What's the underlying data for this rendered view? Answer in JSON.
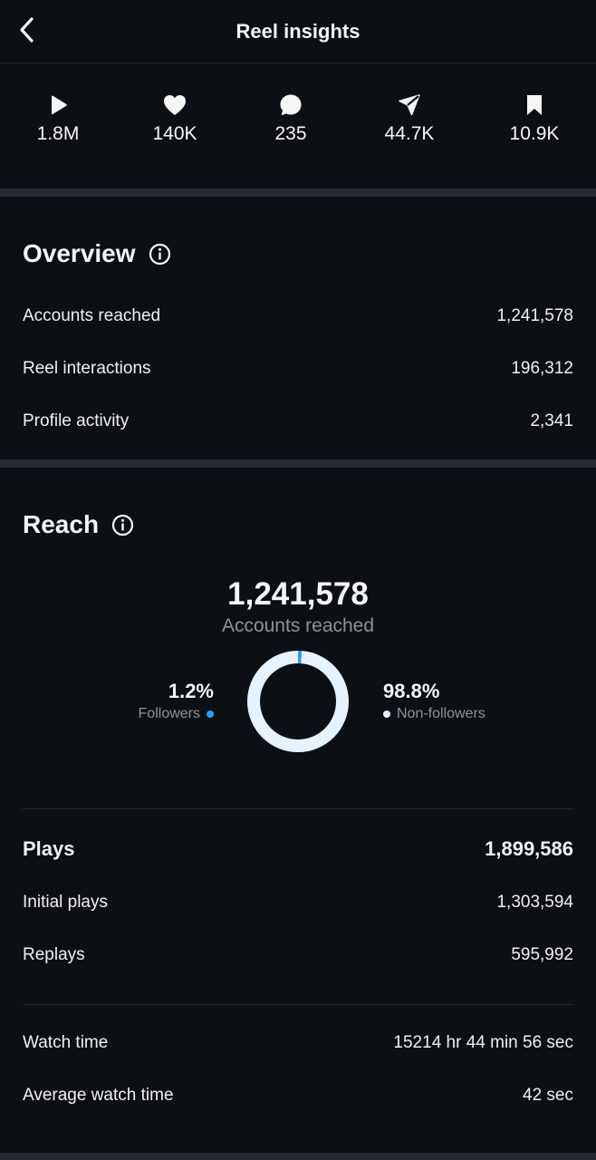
{
  "header": {
    "title": "Reel insights",
    "back_icon": "chevron-left-icon"
  },
  "stats": [
    {
      "icon": "play-icon",
      "value": "1.8M"
    },
    {
      "icon": "heart-icon",
      "value": "140K"
    },
    {
      "icon": "comment-icon",
      "value": "235"
    },
    {
      "icon": "share-icon",
      "value": "44.7K"
    },
    {
      "icon": "bookmark-icon",
      "value": "10.9K"
    }
  ],
  "overview": {
    "title": "Overview",
    "info_icon": "info-icon",
    "rows": [
      {
        "label": "Accounts reached",
        "value": "1,241,578"
      },
      {
        "label": "Reel interactions",
        "value": "196,312"
      },
      {
        "label": "Profile activity",
        "value": "2,341"
      }
    ]
  },
  "reach": {
    "title": "Reach",
    "info_icon": "info-icon",
    "total": "1,241,578",
    "total_label": "Accounts reached",
    "followers": {
      "pct": "1.2%",
      "label": "Followers",
      "fraction": 0.012,
      "color": "#2f9bff"
    },
    "non_followers": {
      "pct": "98.8%",
      "label": "Non-followers",
      "fraction": 0.988,
      "color": "#e6f3ff"
    }
  },
  "plays": {
    "label": "Plays",
    "value": "1,899,586",
    "rows": [
      {
        "label": "Initial plays",
        "value": "1,303,594"
      },
      {
        "label": "Replays",
        "value": "595,992"
      }
    ]
  },
  "watch": {
    "rows": [
      {
        "label": "Watch time",
        "value": "15214 hr 44 min 56 sec"
      },
      {
        "label": "Average watch time",
        "value": "42 sec"
      }
    ]
  },
  "colors": {
    "background": "#0c1014",
    "divider": "#262a30",
    "text": "#f5f5f5",
    "muted": "#8e9399",
    "accent_blue": "#2f9bff"
  }
}
